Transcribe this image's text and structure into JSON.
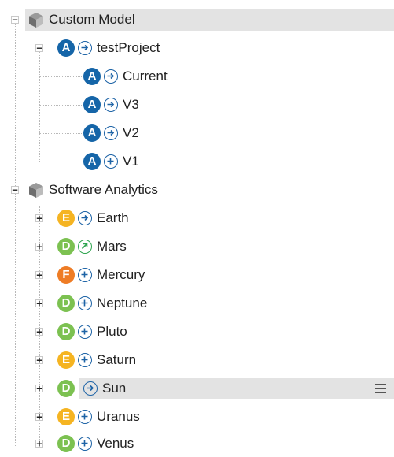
{
  "tree": {
    "custom_model": {
      "label": "Custom Model",
      "project": {
        "label": "testProject",
        "badge": "A",
        "versions": [
          {
            "badge": "A",
            "label": "Current"
          },
          {
            "badge": "A",
            "label": "V3"
          },
          {
            "badge": "A",
            "label": "V2"
          },
          {
            "badge": "A",
            "label": "V1"
          }
        ]
      }
    },
    "software_analytics": {
      "label": "Software Analytics",
      "projects": [
        {
          "badge": "E",
          "label": "Earth"
        },
        {
          "badge": "D",
          "label": "Mars"
        },
        {
          "badge": "F",
          "label": "Mercury"
        },
        {
          "badge": "D",
          "label": "Neptune"
        },
        {
          "badge": "D",
          "label": "Pluto"
        },
        {
          "badge": "E",
          "label": "Saturn"
        },
        {
          "badge": "D",
          "label": "Sun"
        },
        {
          "badge": "E",
          "label": "Uranus"
        },
        {
          "badge": "D",
          "label": "Venus"
        }
      ]
    }
  },
  "colors": {
    "badge_A": "#1565a8",
    "badge_D": "#7cc151",
    "badge_E": "#f5b422",
    "badge_F": "#ee7c25",
    "status_blue": "#1d63a6",
    "status_green": "#2da44e"
  },
  "icons": {
    "expanded": "minus-toggle-icon",
    "collapsed": "plus-toggle-icon",
    "group": "cube-icon",
    "status_arrow": "arrow-right-circle-icon",
    "status_plus": "plus-circle-icon",
    "status_up": "arrow-up-right-circle-icon",
    "row_menu": "hamburger-menu-icon"
  }
}
